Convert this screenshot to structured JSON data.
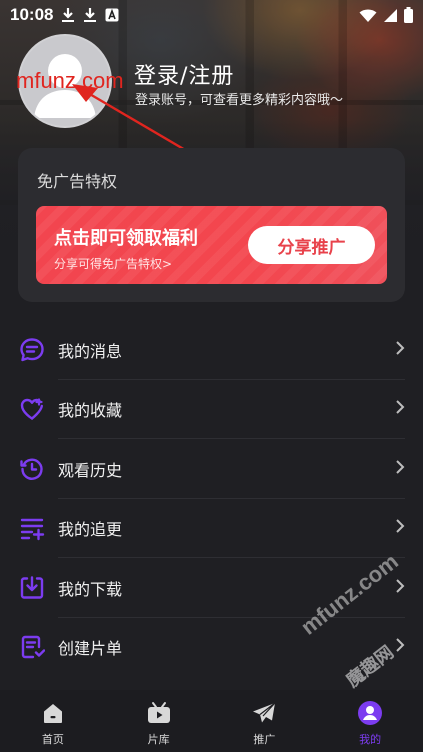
{
  "status_bar": {
    "time": "10:08"
  },
  "profile": {
    "login_title": "登录/注册",
    "login_subtitle": "登录账号，可查看更多精彩内容哦～",
    "watermark": "mfunz.com"
  },
  "ad_card": {
    "title": "免广告特权",
    "promo_title": "点击即可领取福利",
    "promo_subtitle": "分享可得免广告特权>",
    "share_button": "分享推广"
  },
  "menu": {
    "items": [
      {
        "label": "我的消息",
        "icon": "message-icon"
      },
      {
        "label": "我的收藏",
        "icon": "heart-icon"
      },
      {
        "label": "观看历史",
        "icon": "history-icon"
      },
      {
        "label": "我的追更",
        "icon": "follow-list-icon"
      },
      {
        "label": "我的下载",
        "icon": "download-icon"
      },
      {
        "label": "创建片单",
        "icon": "playlist-icon"
      }
    ]
  },
  "tabbar": {
    "tabs": [
      {
        "label": "首页",
        "icon": "home-icon",
        "active": false
      },
      {
        "label": "片库",
        "icon": "library-icon",
        "active": false
      },
      {
        "label": "推广",
        "icon": "send-icon",
        "active": false
      },
      {
        "label": "我的",
        "icon": "profile-icon",
        "active": true
      }
    ]
  },
  "watermark_bottom": {
    "latin": "mfunz.com",
    "chinese": "魔趣网"
  },
  "colors": {
    "accent": "#7c3cf0",
    "promo_red": "#f2454f",
    "background": "#1f1f23",
    "card": "#2c2c30"
  }
}
